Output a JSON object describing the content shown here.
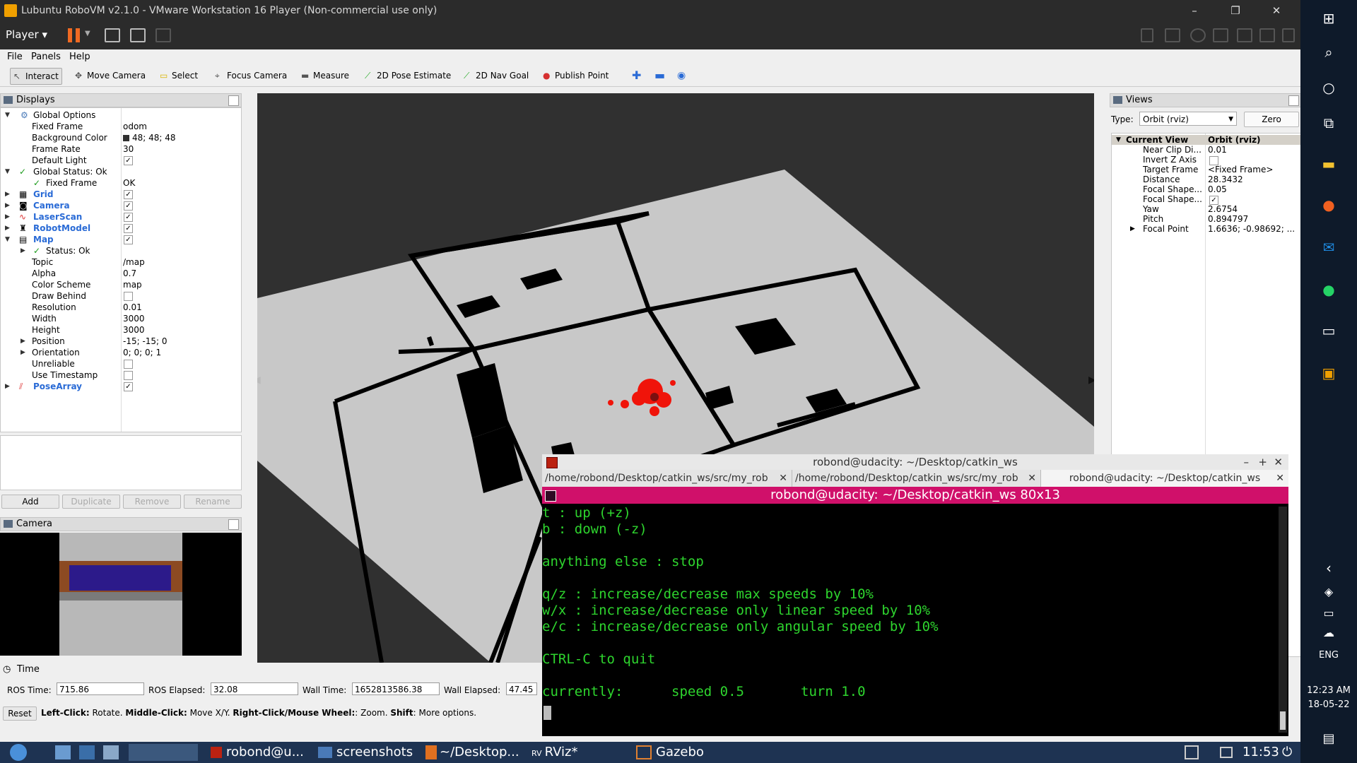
{
  "vm": {
    "title": "Lubuntu RoboVM v2.1.0 - VMware Workstation 16 Player (Non-commercial use only)",
    "player_label": "Player"
  },
  "menu": [
    "File",
    "Panels",
    "Help"
  ],
  "toolbar": {
    "interact": "Interact",
    "move_camera": "Move Camera",
    "select": "Select",
    "focus_camera": "Focus Camera",
    "measure": "Measure",
    "pose_estimate": "2D Pose Estimate",
    "nav_goal": "2D Nav Goal",
    "publish_point": "Publish Point"
  },
  "displays": {
    "title": "Displays",
    "rows": [
      {
        "key": "Global Options",
        "value": ""
      },
      {
        "key": "Fixed Frame",
        "value": "odom"
      },
      {
        "key": "Background Color",
        "value": "48; 48; 48"
      },
      {
        "key": "Frame Rate",
        "value": "30"
      },
      {
        "key": "Default Light",
        "value": ""
      },
      {
        "key": "Global Status: Ok",
        "value": ""
      },
      {
        "key": "Fixed Frame",
        "value": "OK"
      },
      {
        "key": "Grid",
        "value": ""
      },
      {
        "key": "Camera",
        "value": ""
      },
      {
        "key": "LaserScan",
        "value": ""
      },
      {
        "key": "RobotModel",
        "value": ""
      },
      {
        "key": "Map",
        "value": ""
      },
      {
        "key": "Status: Ok",
        "value": ""
      },
      {
        "key": "Topic",
        "value": "/map"
      },
      {
        "key": "Alpha",
        "value": "0.7"
      },
      {
        "key": "Color Scheme",
        "value": "map"
      },
      {
        "key": "Draw Behind",
        "value": ""
      },
      {
        "key": "Resolution",
        "value": "0.01"
      },
      {
        "key": "Width",
        "value": "3000"
      },
      {
        "key": "Height",
        "value": "3000"
      },
      {
        "key": "Position",
        "value": "-15; -15; 0"
      },
      {
        "key": "Orientation",
        "value": "0; 0; 0; 1"
      },
      {
        "key": "Unreliable",
        "value": ""
      },
      {
        "key": "Use Timestamp",
        "value": ""
      },
      {
        "key": "PoseArray",
        "value": ""
      }
    ],
    "buttons": {
      "add": "Add",
      "duplicate": "Duplicate",
      "remove": "Remove",
      "rename": "Rename"
    }
  },
  "camera_panel": {
    "title": "Camera"
  },
  "views": {
    "title": "Views",
    "type_label": "Type:",
    "type_value": "Orbit (rviz)",
    "zero": "Zero",
    "header_key": "Current View",
    "header_value": "Orbit (rviz)",
    "rows": [
      {
        "key": "Near Clip Di...",
        "value": "0.01"
      },
      {
        "key": "Invert Z Axis",
        "value": ""
      },
      {
        "key": "Target Frame",
        "value": "<Fixed Frame>"
      },
      {
        "key": "Distance",
        "value": "28.3432"
      },
      {
        "key": "Focal Shape...",
        "value": "0.05"
      },
      {
        "key": "Focal Shape...",
        "value": ""
      },
      {
        "key": "Yaw",
        "value": "2.6754"
      },
      {
        "key": "Pitch",
        "value": "0.894797"
      },
      {
        "key": "Focal Point",
        "value": "1.6636; -0.98692; ..."
      }
    ]
  },
  "time": {
    "title": "Time",
    "ros_time_label": "ROS Time:",
    "ros_time": "715.86",
    "ros_elapsed_label": "ROS Elapsed:",
    "ros_elapsed": "32.08",
    "wall_time_label": "Wall Time:",
    "wall_time": "1652813586.38",
    "wall_elapsed_label": "Wall Elapsed:",
    "wall_elapsed": "47.45",
    "reset": "Reset",
    "hint_a": "Left-Click:",
    "hint_b": " Rotate. ",
    "hint_c": "Middle-Click:",
    "hint_d": " Move X/Y. ",
    "hint_e": "Right-Click/Mouse Wheel:",
    "hint_f": ": Zoom. ",
    "hint_g": "Shift",
    "hint_h": ": More options."
  },
  "terminal": {
    "title": "robond@udacity: ~/Desktop/catkin_ws",
    "tabs": [
      "/home/robond/Desktop/catkin_ws/src/my_rob",
      "/home/robond/Desktop/catkin_ws/src/my_rob",
      "robond@udacity: ~/Desktop/catkin_ws"
    ],
    "banner": "robond@udacity: ~/Desktop/catkin_ws 80x13",
    "lines": [
      "t : up (+z)",
      "b : down (-z)",
      "",
      "anything else : stop",
      "",
      "q/z : increase/decrease max speeds by 10%",
      "w/x : increase/decrease only linear speed by 10%",
      "e/c : increase/decrease only angular speed by 10%",
      "",
      "CTRL-C to quit",
      "",
      "currently:      speed 0.5       turn 1.0"
    ]
  },
  "taskbar": {
    "items": [
      "robond@u...",
      "screenshots",
      "~/Desktop...",
      "RViz*",
      "Gazebo"
    ],
    "clock": "11:53"
  },
  "windows_side": {
    "lang": "ENG",
    "time": "12:23 AM",
    "date": "18-05-22"
  },
  "colors": {
    "accent_orange": "#f06a22",
    "terminal_green": "#2ed52e",
    "terminal_pink": "#d0106a"
  }
}
